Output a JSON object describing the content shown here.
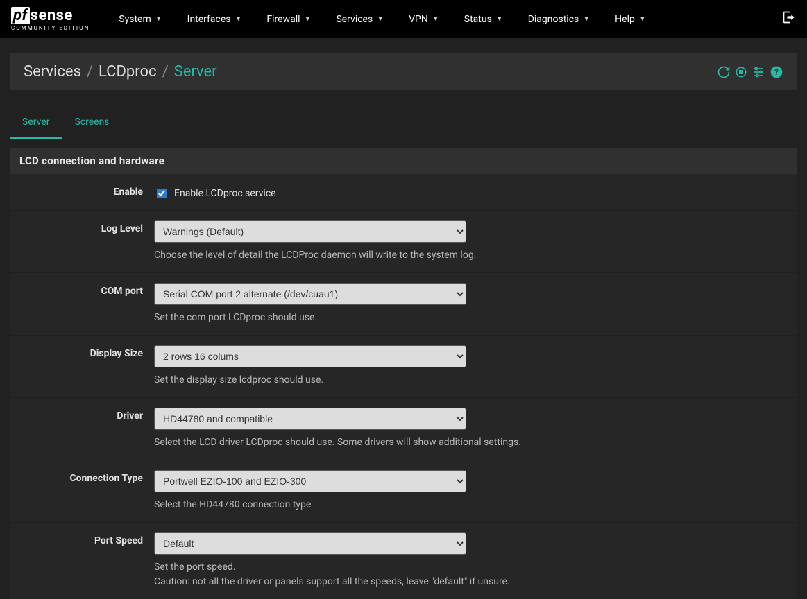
{
  "logo": {
    "pf": "pf",
    "sense": "sense",
    "sub": "COMMUNITY EDITION"
  },
  "nav": [
    "System",
    "Interfaces",
    "Firewall",
    "Services",
    "VPN",
    "Status",
    "Diagnostics",
    "Help"
  ],
  "breadcrumb": {
    "a": "Services",
    "b": "LCDproc",
    "c": "Server"
  },
  "tabs": {
    "server": "Server",
    "screens": "Screens"
  },
  "panel_title": "LCD connection and hardware",
  "fields": {
    "enable": {
      "label": "Enable",
      "text": "Enable LCDproc service"
    },
    "loglevel": {
      "label": "Log Level",
      "value": "Warnings (Default)",
      "help": "Choose the level of detail the LCDProc daemon will write to the system log."
    },
    "comport": {
      "label": "COM port",
      "value": "Serial COM port 2 alternate (/dev/cuau1)",
      "help": "Set the com port LCDproc should use."
    },
    "displaysize": {
      "label": "Display Size",
      "value": "2 rows 16 colums",
      "help": "Set the display size lcdproc should use."
    },
    "driver": {
      "label": "Driver",
      "value": "HD44780 and compatible",
      "help": "Select the LCD driver LCDproc should use. Some drivers will show additional settings."
    },
    "conntype": {
      "label": "Connection Type",
      "value": "Portwell EZIO-100 and EZIO-300",
      "help": "Select the HD44780 connection type"
    },
    "portspeed": {
      "label": "Port Speed",
      "value": "Default",
      "help": "Set the port speed.\nCaution: not all the driver or panels support all the speeds, leave \"default\" if unsure."
    }
  }
}
